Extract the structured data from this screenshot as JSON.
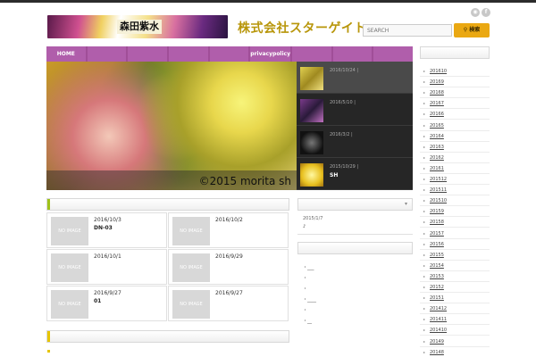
{
  "header": {
    "logo_text": "森田紫水",
    "company": "株式会社スターゲイト",
    "search_placeholder": "SEARCH",
    "search_button": "検索",
    "social": [
      "rss-icon",
      "facebook-icon"
    ]
  },
  "nav": {
    "items": [
      "HOME",
      "",
      "",
      "",
      "",
      "privacypolicy",
      "",
      "",
      ""
    ]
  },
  "hero": {
    "caption": "©2015 morita sh"
  },
  "slides": [
    {
      "date": "2016/10/24  |",
      "title": ""
    },
    {
      "date": "2016/5/10  |",
      "title": ""
    },
    {
      "date": "2016/3/2  |",
      "title": ""
    },
    {
      "date": "2015/10/29  |",
      "title": "SH"
    }
  ],
  "posts": [
    {
      "date": "2016/10/3",
      "title": "DN-03",
      "image_label": "NO IMAGE"
    },
    {
      "date": "2016/10/2",
      "title": "",
      "image_label": "NO IMAGE"
    },
    {
      "date": "2016/10/1",
      "title": "",
      "image_label": "NO IMAGE"
    },
    {
      "date": "2016/9/29",
      "title": "",
      "image_label": "NO IMAGE"
    },
    {
      "date": "2016/9/27",
      "title": "01",
      "image_label": "NO IMAGE"
    },
    {
      "date": "2016/9/27",
      "title": "",
      "image_label": "NO IMAGE"
    }
  ],
  "widget1": {
    "date": "2015/1/7",
    "title": "♪"
  },
  "widget2": {
    "links": [
      "・___",
      "・",
      "・",
      "・____",
      "・",
      "・__"
    ]
  },
  "archives": [
    "201610",
    "20169",
    "20168",
    "20167",
    "20166",
    "20165",
    "20164",
    "20163",
    "20162",
    "20161",
    "201512",
    "201511",
    "201510",
    "20159",
    "20158",
    "20157",
    "20156",
    "20155",
    "20154",
    "20153",
    "20152",
    "20151",
    "201412",
    "201411",
    "201410",
    "20149",
    "20148"
  ]
}
